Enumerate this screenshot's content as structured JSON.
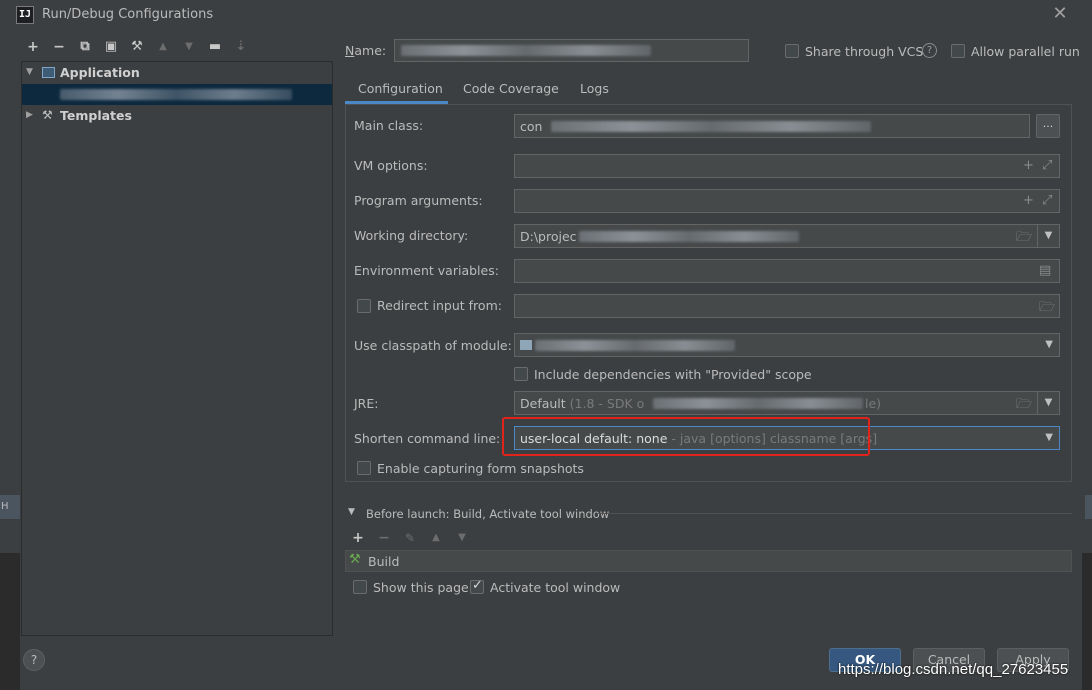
{
  "window": {
    "title": "Run/Debug Configurations",
    "app_icon_text": "IJ",
    "close_icon": "close-icon"
  },
  "toolbar": {
    "items": [
      {
        "name": "add-icon",
        "glyph": "+"
      },
      {
        "name": "remove-icon",
        "glyph": "−"
      },
      {
        "name": "copy-icon",
        "glyph": "⧉"
      },
      {
        "name": "save-icon",
        "glyph": "▣"
      },
      {
        "name": "wrench-icon",
        "glyph": "🔧"
      },
      {
        "name": "move-up-icon",
        "glyph": "▲"
      },
      {
        "name": "move-down-icon",
        "glyph": "▼"
      },
      {
        "name": "new-folder-icon",
        "glyph": "🗀"
      },
      {
        "name": "sort-icon",
        "glyph": "↓"
      }
    ]
  },
  "tree": {
    "application_label": "Application",
    "templates_label": "Templates"
  },
  "header": {
    "name_label": "Name:",
    "share_vcs_label": "Share through VCS",
    "allow_parallel_label": "Allow parallel run"
  },
  "tabs": [
    {
      "label": "Configuration",
      "active": true
    },
    {
      "label": "Code Coverage",
      "active": false
    },
    {
      "label": "Logs",
      "active": false
    }
  ],
  "form": {
    "main_class_label": "Main class:",
    "main_class_value": "con",
    "browse_button": "...",
    "vm_options_label": "VM options:",
    "program_args_label": "Program arguments:",
    "working_dir_label": "Working directory:",
    "working_dir_value": "D:\\projec",
    "env_vars_label": "Environment variables:",
    "redirect_input_label": "Redirect input from:",
    "classpath_label": "Use classpath of module:",
    "include_deps_label": "Include dependencies with \"Provided\" scope",
    "jre_label": "JRE:",
    "jre_value": "Default",
    "jre_hint": "(1.8 - SDK o",
    "jre_hint_end": "le)",
    "shorten_label": "Shorten command line:",
    "shorten_value": "user-local default: none",
    "shorten_hint": "- java [options] classname [args]",
    "capture_snapshots_label": "Enable capturing form snapshots"
  },
  "before_launch": {
    "header": "Before launch: Build, Activate tool window",
    "build_item": "Build",
    "show_page_label": "Show this page",
    "show_page_checked": false,
    "activate_tool_label": "Activate tool window",
    "activate_tool_checked": true
  },
  "buttons": {
    "ok": "OK",
    "cancel": "Cancel",
    "apply": "Apply",
    "help": "?"
  },
  "watermark": "https://blog.csdn.net/qq_27623455",
  "colors": {
    "background": "#3c3f41",
    "accent": "#4a88c7",
    "highlight_box": "#e0241b",
    "selection": "#0d293e"
  }
}
